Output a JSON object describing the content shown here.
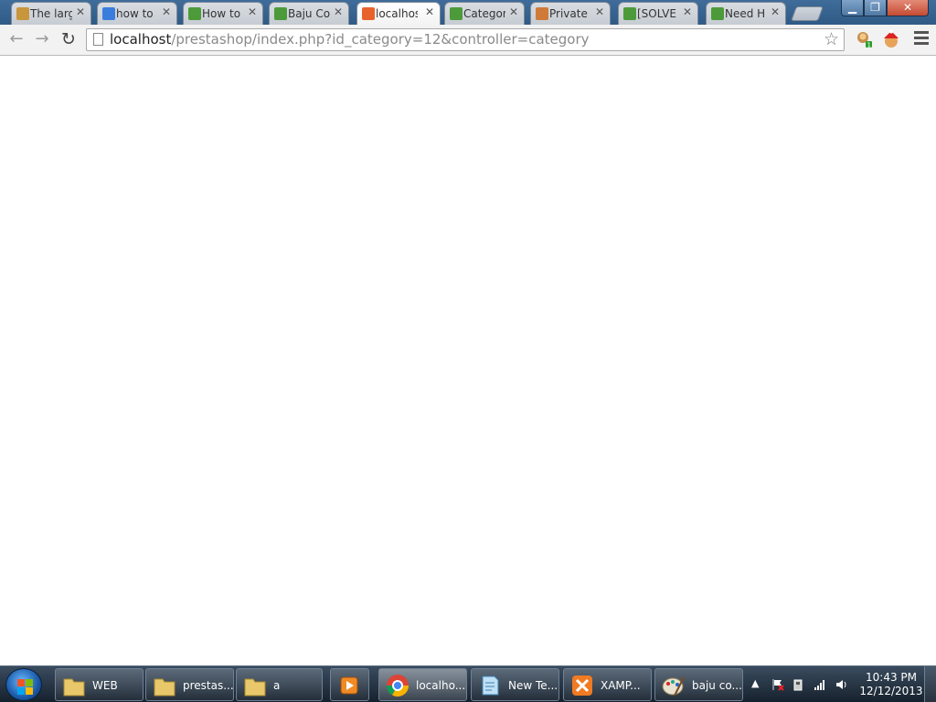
{
  "browser": {
    "tabs": [
      {
        "title": "The larg",
        "icon": "tiger-icon",
        "color": "#c8963c"
      },
      {
        "title": "how to",
        "icon": "google-icon",
        "color": "#3b7ddd"
      },
      {
        "title": "How to",
        "icon": "prestashop-icon",
        "color": "#4d9a3a"
      },
      {
        "title": "Baju Co",
        "icon": "prestashop-icon",
        "color": "#4d9a3a"
      },
      {
        "title": "localhos",
        "icon": "xampp-icon",
        "color": "#e8632b",
        "active": true
      },
      {
        "title": "Categor",
        "icon": "prestashop-icon",
        "color": "#4d9a3a"
      },
      {
        "title": "Private",
        "icon": "cross-icon",
        "color": "#d07a3a"
      },
      {
        "title": "[SOLVE",
        "icon": "prestashop-icon",
        "color": "#4d9a3a"
      },
      {
        "title": "Need H",
        "icon": "prestashop-icon",
        "color": "#4d9a3a"
      }
    ],
    "address": {
      "host": "localhost",
      "path": "/prestashop/index.php?id_category=12&controller=category"
    }
  },
  "taskbar": {
    "items": [
      {
        "label": "WEB",
        "icon": "folder-icon"
      },
      {
        "label": "prestas...",
        "icon": "folder-icon"
      },
      {
        "label": "a",
        "icon": "folder-icon"
      },
      {
        "label": "",
        "icon": "media-player-icon"
      },
      {
        "label": "localho...",
        "icon": "chrome-icon",
        "active": true
      },
      {
        "label": "New Te...",
        "icon": "notepad-icon"
      },
      {
        "label": "XAMP...",
        "icon": "xampp-icon"
      },
      {
        "label": "baju co...",
        "icon": "paint-icon"
      }
    ],
    "clock": {
      "time": "10:43 PM",
      "date": "12/12/2013"
    }
  }
}
